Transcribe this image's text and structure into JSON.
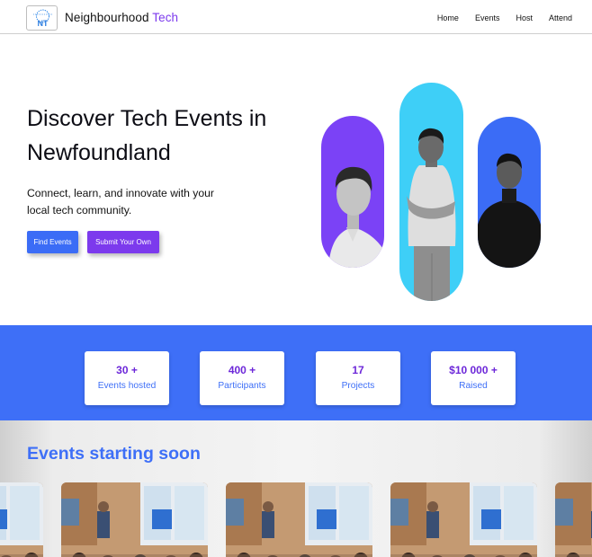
{
  "nav": {
    "logo_icon": "neighbourhood-tech-logo",
    "logo_letters": "NT",
    "brand_main": "Neighbourhood",
    "brand_accent": "Tech",
    "links": [
      "Home",
      "Events",
      "Host",
      "Attend"
    ]
  },
  "hero": {
    "title": "Discover Tech Events in Newfoundland",
    "subtitle": "Connect, learn, and innovate with your local tech community.",
    "primary_button": "Find Events",
    "secondary_button": "Submit Your Own"
  },
  "stats": [
    {
      "value": "30 +",
      "label": "Events hosted"
    },
    {
      "value": "400 +",
      "label": "Participants"
    },
    {
      "value": "17",
      "label": "Projects"
    },
    {
      "value": "$10 000 +",
      "label": "Raised"
    }
  ],
  "events": {
    "title": "Events starting soon",
    "cards_count_visible": 5
  },
  "colors": {
    "primary_blue": "#3e6ff7",
    "purple": "#7c3aed",
    "cyan": "#3ecff7"
  }
}
